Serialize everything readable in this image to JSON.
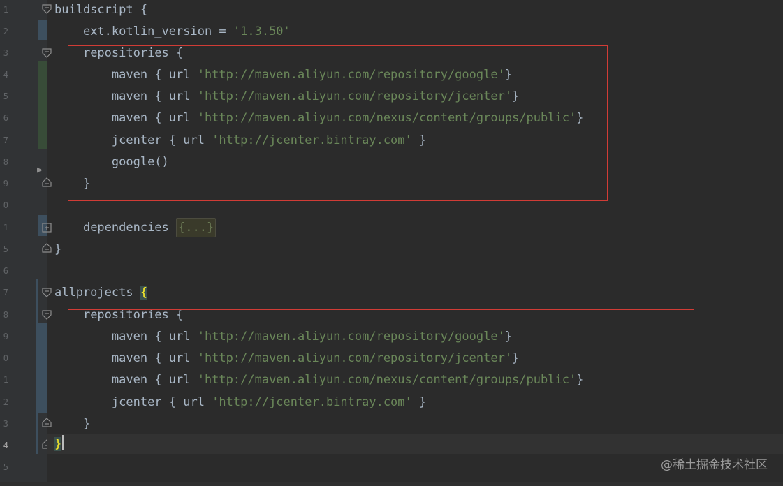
{
  "editor": {
    "line_numbers": [
      "1",
      "2",
      "3",
      "4",
      "5",
      "6",
      "7",
      "8",
      "9",
      "0",
      "1",
      "5",
      "6",
      "7",
      "8",
      "9",
      "0",
      "1",
      "2",
      "3",
      "4",
      "5"
    ],
    "current_line_number": "4"
  },
  "code": {
    "buildscript": {
      "open": "buildscript {",
      "ext_prefix": "ext.kotlin_version = ",
      "ext_value": "'1.3.50'",
      "repositories_open": "repositories {",
      "repos": [
        {
          "prefix": "maven { url ",
          "url": "'http://maven.aliyun.com/repository/google'",
          "suffix": "}"
        },
        {
          "prefix": "maven { url ",
          "url": "'http://maven.aliyun.com/repository/jcenter'",
          "suffix": "}"
        },
        {
          "prefix": "maven { url ",
          "url": "'http://maven.aliyun.com/nexus/content/groups/public'",
          "suffix": "}"
        },
        {
          "prefix": "jcenter { url ",
          "url": "'http://jcenter.bintray.com'",
          "suffix": " }"
        }
      ],
      "google": "google()",
      "repositories_close": "}",
      "dependencies_label": "dependencies ",
      "dependencies_folded": "{...}",
      "close": "}"
    },
    "allprojects": {
      "open_label": "allprojects ",
      "open_brace": "{",
      "repositories_open": "repositories {",
      "repos": [
        {
          "prefix": "maven { url ",
          "url": "'http://maven.aliyun.com/repository/google'",
          "suffix": "}"
        },
        {
          "prefix": "maven { url ",
          "url": "'http://maven.aliyun.com/repository/jcenter'",
          "suffix": "}"
        },
        {
          "prefix": "maven { url ",
          "url": "'http://maven.aliyun.com/nexus/content/groups/public'",
          "suffix": "}"
        },
        {
          "prefix": "jcenter { url ",
          "url": "'http://jcenter.bintray.com'",
          "suffix": " }"
        }
      ],
      "repositories_close": "}",
      "close": "}"
    }
  },
  "watermark": "@稀土掘金技术社区",
  "colors": {
    "background": "#2b2b2b",
    "gutter": "#313335",
    "code_text": "#a9b7c6",
    "string": "#6a8759",
    "highlight_box": "#d13c36",
    "matched_brace": "#ffef28"
  },
  "icons": {
    "fold_collapse": "fold-collapse-icon",
    "fold_end": "fold-end-icon",
    "fold_expand": "fold-expand-icon",
    "run": "run-arrow-icon"
  }
}
